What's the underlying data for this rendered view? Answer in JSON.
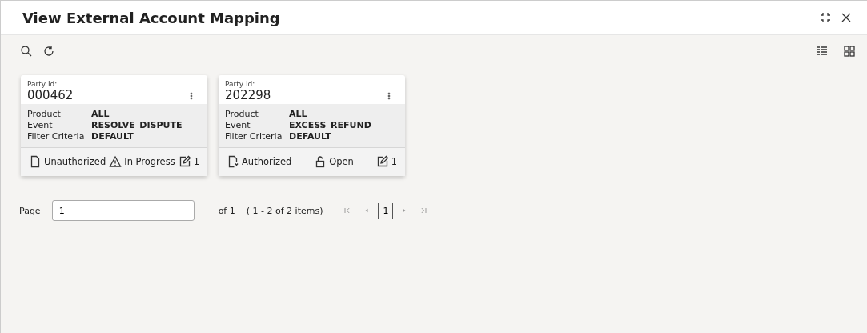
{
  "window": {
    "title": "View External Account Mapping"
  },
  "cards": [
    {
      "party_label": "Party Id:",
      "party_id": "000462",
      "fields": [
        {
          "label": "Product",
          "value": "ALL"
        },
        {
          "label": "Event",
          "value": "RESOLVE_DISPUTE"
        },
        {
          "label": "Filter Criteria",
          "value": "DEFAULT"
        }
      ],
      "statuses": [
        {
          "kind": "document",
          "text": "Unauthorized"
        },
        {
          "kind": "warning",
          "text": "In Progress"
        },
        {
          "kind": "edit",
          "text": "1"
        }
      ]
    },
    {
      "party_label": "Party Id:",
      "party_id": "202298",
      "fields": [
        {
          "label": "Product",
          "value": "ALL"
        },
        {
          "label": "Event",
          "value": "EXCESS_REFUND"
        },
        {
          "label": "Filter Criteria",
          "value": "DEFAULT"
        }
      ],
      "statuses": [
        {
          "kind": "document-check",
          "text": "Authorized"
        },
        {
          "kind": "unlock",
          "text": "Open"
        },
        {
          "kind": "edit",
          "text": "1"
        }
      ]
    }
  ],
  "pagination": {
    "label": "Page",
    "value": "1",
    "of": "of 1",
    "range": "( 1 - 2 of 2 items)",
    "pages": [
      {
        "label": "1",
        "selected": true
      }
    ]
  }
}
